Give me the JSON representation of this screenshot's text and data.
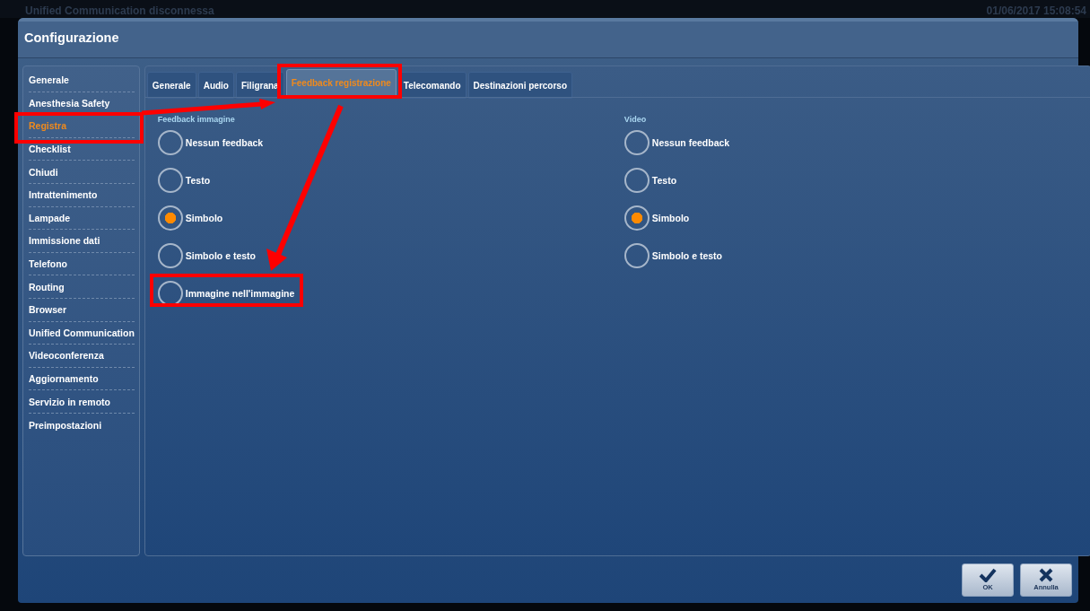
{
  "status_bar": {
    "message": "Unified Communication disconnessa",
    "datetime": "01/06/2017  15:08:54"
  },
  "window": {
    "title": "Configurazione"
  },
  "sidebar": {
    "items": [
      {
        "label": "Generale",
        "selected": false
      },
      {
        "label": "Anesthesia Safety",
        "selected": false
      },
      {
        "label": "Registra",
        "selected": true
      },
      {
        "label": "Checklist",
        "selected": false
      },
      {
        "label": "Chiudi",
        "selected": false
      },
      {
        "label": "Intrattenimento",
        "selected": false
      },
      {
        "label": "Lampade",
        "selected": false
      },
      {
        "label": "Immissione dati",
        "selected": false
      },
      {
        "label": "Telefono",
        "selected": false
      },
      {
        "label": "Routing",
        "selected": false
      },
      {
        "label": "Browser",
        "selected": false
      },
      {
        "label": "Unified Communication",
        "selected": false
      },
      {
        "label": "Videoconferenza",
        "selected": false
      },
      {
        "label": "Aggiornamento",
        "selected": false
      },
      {
        "label": "Servizio in remoto",
        "selected": false
      },
      {
        "label": "Preimpostazioni",
        "selected": false
      }
    ]
  },
  "tabs": [
    {
      "label": "Generale",
      "selected": false
    },
    {
      "label": "Audio",
      "selected": false
    },
    {
      "label": "Filigrana",
      "selected": false
    },
    {
      "label": "Feedback registrazione",
      "selected": true
    },
    {
      "label": "Telecomando",
      "selected": false
    },
    {
      "label": "Destinazioni percorso",
      "selected": false
    }
  ],
  "groups": [
    {
      "title": "Feedback immagine",
      "options": [
        {
          "label": "Nessun feedback",
          "selected": false
        },
        {
          "label": "Testo",
          "selected": false
        },
        {
          "label": "Simbolo",
          "selected": true
        },
        {
          "label": "Simbolo e testo",
          "selected": false
        },
        {
          "label": "Immagine nell'immagine",
          "selected": false
        }
      ]
    },
    {
      "title": "Video",
      "options": [
        {
          "label": "Nessun feedback",
          "selected": false
        },
        {
          "label": "Testo",
          "selected": false
        },
        {
          "label": "Simbolo",
          "selected": true
        },
        {
          "label": "Simbolo e testo",
          "selected": false
        }
      ]
    }
  ],
  "buttons": [
    {
      "label": "OK",
      "kind": "ok"
    },
    {
      "label": "Annulla",
      "kind": "cancel"
    }
  ]
}
